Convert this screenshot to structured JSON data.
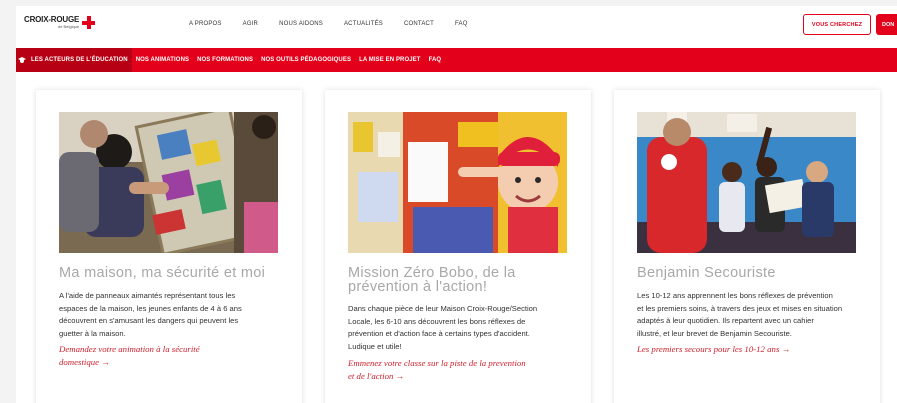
{
  "header": {
    "logo": {
      "name": "CROIX-ROUGE",
      "sub": "de Belgique"
    },
    "nav": [
      "A PROPOS",
      "AGIR",
      "NOUS AIDONS",
      "ACTUALITÉS",
      "CONTACT",
      "FAQ"
    ],
    "search_button": "VOUS CHERCHEZ",
    "don_button": "DON"
  },
  "subnav": [
    "LES ACTEURS DE L'ÉDUCATION",
    "NOS ANIMATIONS",
    "NOS FORMATIONS",
    "NOS OUTILS PÉDAGOGIQUES",
    "LA MISE EN PROJET",
    "FAQ"
  ],
  "cards": [
    {
      "title_lines": [
        "Ma maison, ma sécurité et moi"
      ],
      "text_lines": [
        "A l'aide de panneaux aimantés représentant tous les",
        "espaces de la maison, les jeunes enfants de 4 à 6 ans",
        "découvrent en s'amusant les dangers qui peuvent les",
        "guetter à la maison."
      ],
      "link_lines": [
        "Demandez votre animation à la sécurité",
        "domestique →"
      ]
    },
    {
      "title_lines": [
        "Mission Zéro Bobo, de la",
        "prévention à l'action!"
      ],
      "text_lines": [
        "Dans chaque pièce de leur Maison Croix-Rouge/Section",
        "Locale, les 6-10 ans découvrent les bons réflexes de",
        "prévention et d'action face à certains types d'accident.",
        "Ludique et utile!"
      ],
      "link_lines": [
        "Emmenez votre classe sur la piste de la prevention",
        "et de l'action →"
      ]
    },
    {
      "title_lines": [
        "Benjamin Secouriste"
      ],
      "text_lines": [
        "Les 10-12 ans apprennent les bons réflexes de prévention",
        "et les premiers soins, à travers des jeux et mises en situation",
        "adaptés à leur quotidien. Ils repartent avec un cahier",
        "illustré, et leur brevet de Benjamin Secouriste."
      ],
      "link_lines": [
        "Les premiers secours pour les 10-12 ans →"
      ]
    }
  ],
  "colors": {
    "brand_red": "#e2001a",
    "active_tab": "#b80014",
    "title_gray": "#a8a8a8",
    "link_red": "#d0202c"
  }
}
